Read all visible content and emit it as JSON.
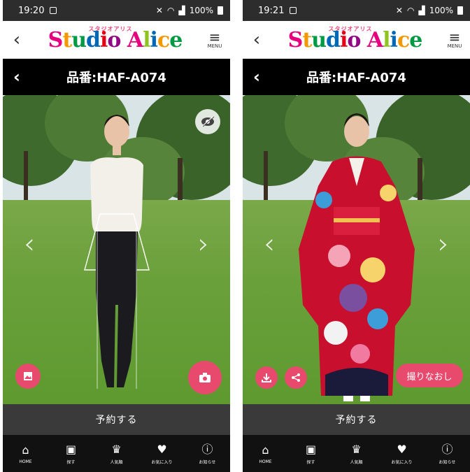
{
  "screens": [
    {
      "id": "left",
      "status": {
        "time": "19:20",
        "battery": "100%"
      },
      "header": {
        "logo_kana": "スタジオアリス",
        "logo_text": "Studio Alice",
        "menu_label": "MENU"
      },
      "title": "品番:HAF-A074",
      "photo": {
        "outfit": "white sweater and black pants with kimono outline overlay"
      },
      "reserve_label": "予約する"
    },
    {
      "id": "right",
      "status": {
        "time": "19:21",
        "battery": "100%"
      },
      "header": {
        "logo_kana": "スタジオアリス",
        "logo_text": "Studio Alice",
        "menu_label": "MENU"
      },
      "title": "品番:HAF-A074",
      "photo": {
        "outfit": "red floral furisode kimono"
      },
      "retake_label": "撮りなおし",
      "reserve_label": "予約する"
    }
  ],
  "bottom_nav": [
    {
      "icon": "home-icon",
      "label": "HOME"
    },
    {
      "icon": "search-dress-icon",
      "label": "探す"
    },
    {
      "icon": "crown-icon",
      "label": "人気順"
    },
    {
      "icon": "heart-icon",
      "label": "お気に入り"
    },
    {
      "icon": "info-icon",
      "label": "お知らせ"
    }
  ],
  "colors": {
    "accent": "#e84a6e",
    "bar": "#000000",
    "reserve": "#3a3a3a",
    "nav": "#111111"
  }
}
